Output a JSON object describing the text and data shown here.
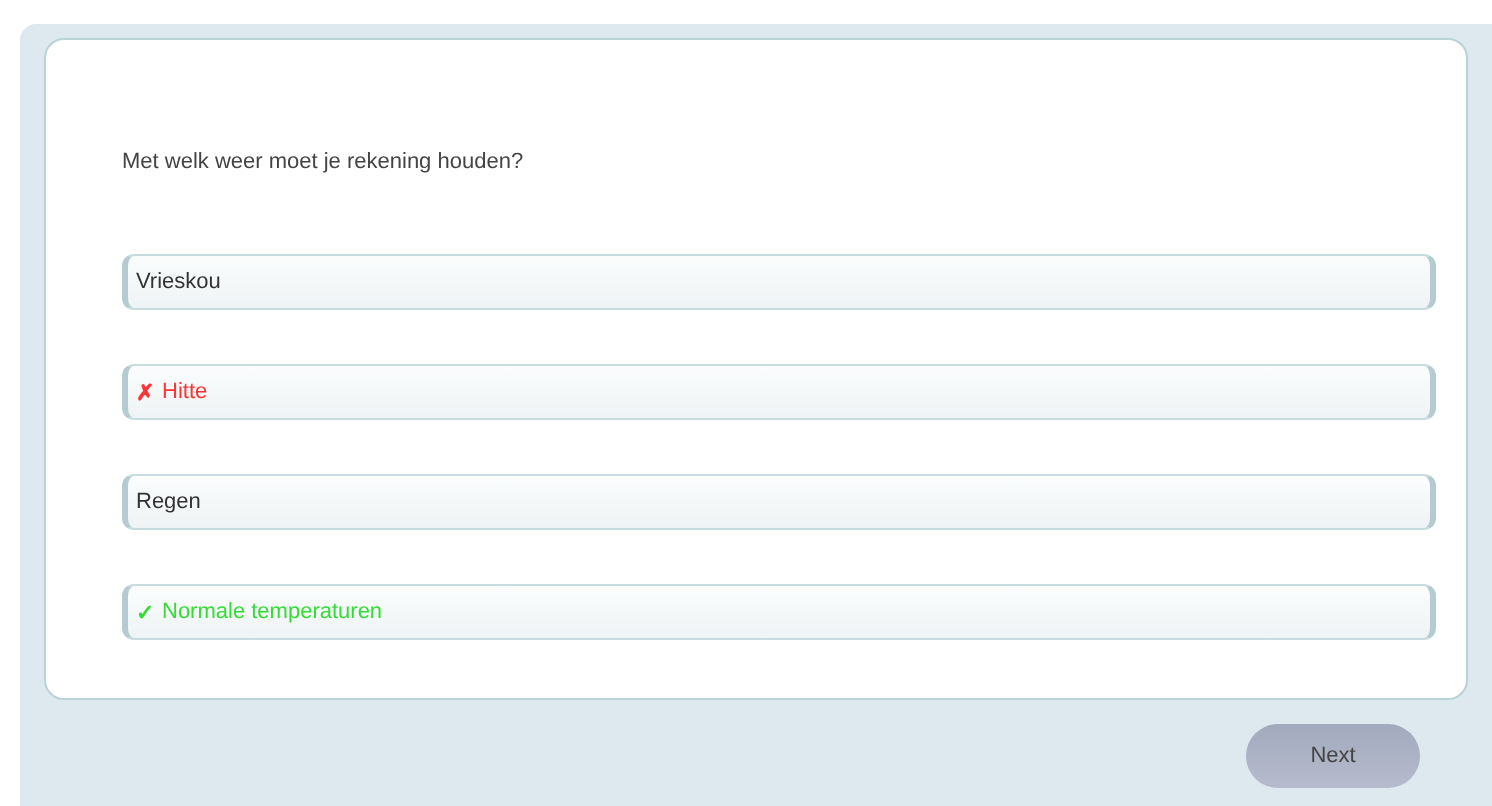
{
  "question": "Met welk weer moet je rekening houden?",
  "options": [
    {
      "label": "Vrieskou",
      "kind": "plain"
    },
    {
      "mark": "✗",
      "label": "Hitte",
      "kind": "wrong"
    },
    {
      "label": "Regen",
      "kind": "plain"
    },
    {
      "mark": "✓",
      "label": "Normale temperaturen",
      "kind": "correct"
    }
  ],
  "buttons": [
    "Next"
  ]
}
